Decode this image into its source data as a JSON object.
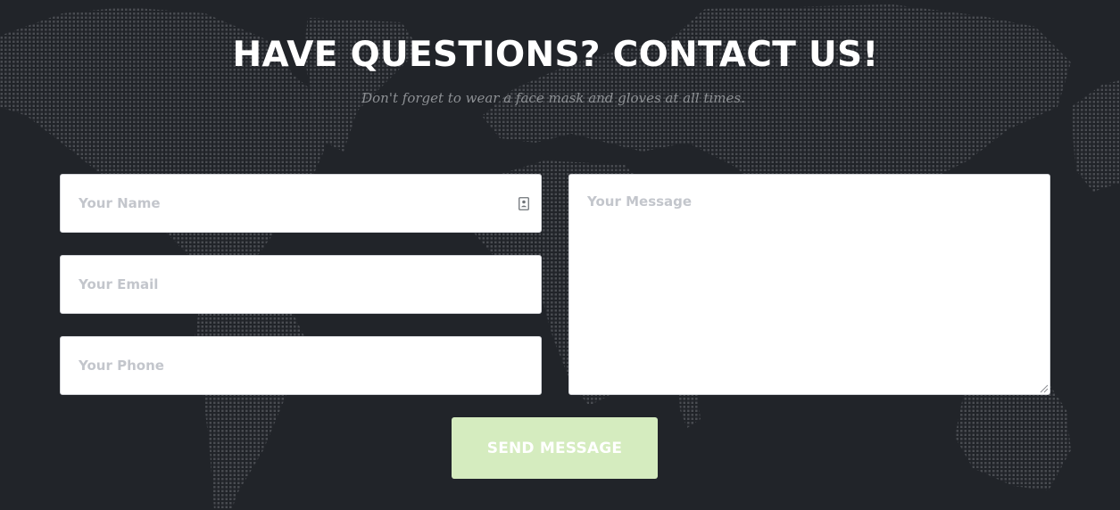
{
  "header": {
    "title": "HAVE QUESTIONS? CONTACT US!",
    "subtitle": "Don't forget to wear a face mask and gloves at all times."
  },
  "form": {
    "name_placeholder": "Your Name",
    "email_placeholder": "Your Email",
    "phone_placeholder": "Your Phone",
    "message_placeholder": "Your Message",
    "name_value": "",
    "email_value": "",
    "phone_value": "",
    "message_value": "",
    "submit_label": "SEND MESSAGE"
  },
  "icons": {
    "name_field_icon": "contact-card-icon",
    "message_resize": "resize-grip-icon",
    "background": "world-map-dots"
  },
  "colors": {
    "background": "#212429",
    "map_dots": "#4a4d52",
    "heading": "#ffffff",
    "subtitle": "#8d9094",
    "field_background": "#ffffff",
    "placeholder": "#c3c6cc",
    "button_background": "#d5ecbf",
    "button_text": "#ffffff"
  }
}
